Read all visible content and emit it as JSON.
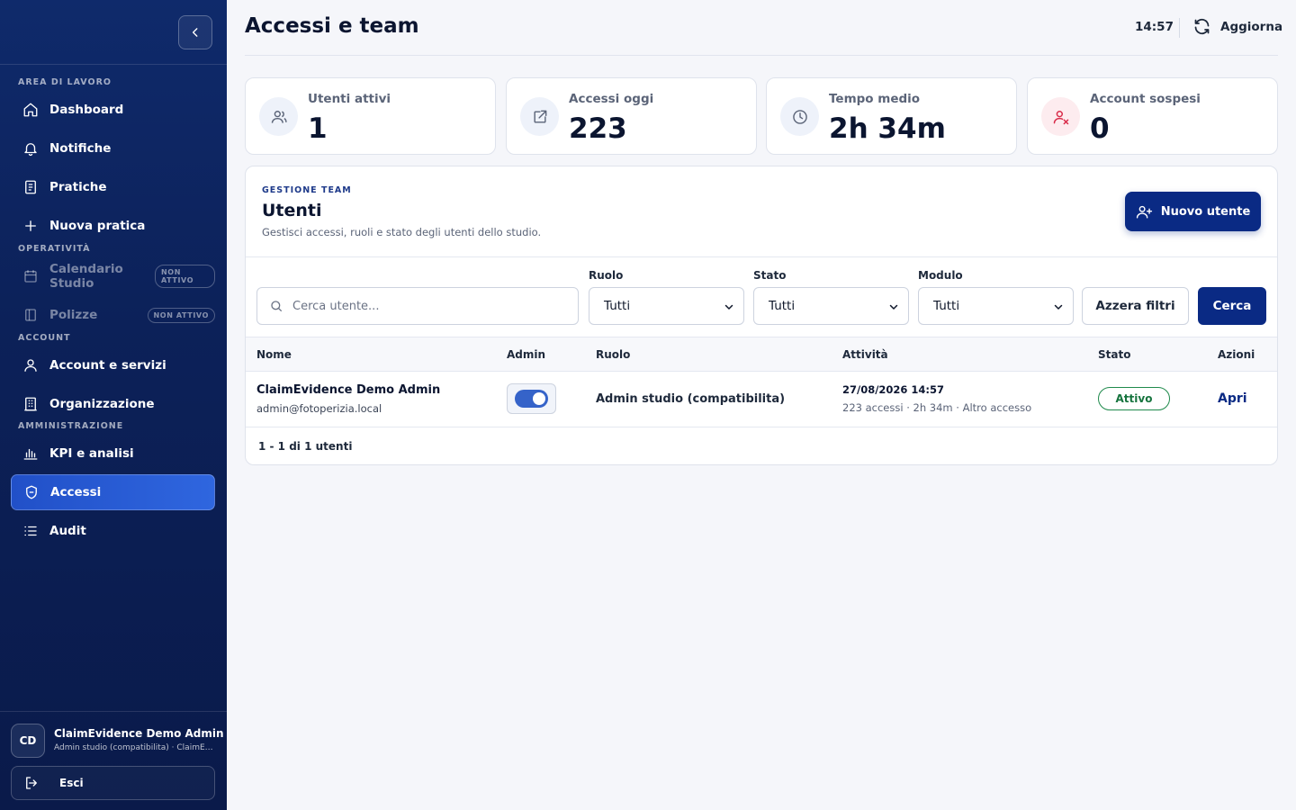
{
  "sidebar": {
    "sections": {
      "workspace": "AREA DI LAVORO",
      "operations": "OPERATIVITÀ",
      "account": "ACCOUNT",
      "admin": "AMMINISTRAZIONE"
    },
    "items": {
      "dashboard": "Dashboard",
      "notifications": "Notifiche",
      "practices": "Pratiche",
      "new_practice": "Nuova pratica",
      "calendar": "Calendario Studio",
      "policies": "Polizze",
      "account_services": "Account e servizi",
      "organization": "Organizzazione",
      "kpi": "KPI e analisi",
      "access": "Accessi",
      "audit": "Audit"
    },
    "inactive_badge": "NON ATTIVO",
    "user": {
      "initials": "CD",
      "name": "ClaimEvidence Demo Admin",
      "role": "Admin studio (compatibilita) · ClaimEvidence"
    },
    "logout_label": "Esci"
  },
  "header": {
    "title": "Accessi e team",
    "clock": "14:57",
    "refresh_label": "Aggiorna"
  },
  "kpis": {
    "active_users": {
      "label": "Utenti attivi",
      "value": "1"
    },
    "access_today": {
      "label": "Accessi oggi",
      "value": "223"
    },
    "avg_time": {
      "label": "Tempo medio",
      "value": "2h 34m"
    },
    "suspended": {
      "label": "Account sospesi",
      "value": "0"
    }
  },
  "panel": {
    "eyebrow": "GESTIONE TEAM",
    "title": "Utenti",
    "subtitle": "Gestisci accessi, ruoli e stato degli utenti dello studio.",
    "new_user_label": "Nuovo utente"
  },
  "filters": {
    "search_placeholder": "Cerca utente...",
    "role_label": "Ruolo",
    "role_value": "Tutti",
    "state_label": "Stato",
    "state_value": "Tutti",
    "module_label": "Modulo",
    "module_value": "Tutti",
    "reset_label": "Azzera filtri",
    "search_label": "Cerca"
  },
  "table": {
    "columns": {
      "name": "Nome",
      "admin": "Admin",
      "role": "Ruolo",
      "activity": "Attività",
      "state": "Stato",
      "actions": "Azioni"
    },
    "rows": [
      {
        "name": "ClaimEvidence Demo Admin",
        "email": "admin@fotoperizia.local",
        "admin": true,
        "role": "Admin studio (compatibilita)",
        "activity_date": "27/08/2026 14:57",
        "activity_detail": "223 accessi · 2h 34m · Altro accesso",
        "state": "Attivo",
        "action": "Apri"
      }
    ],
    "pager": "1 - 1 di 1 utenti"
  },
  "colors": {
    "primary": "#0a2a84",
    "sidebar": "#0c2159",
    "active_nav": "#2f66df",
    "status_ok": "#1f8a4c",
    "alert": "#d92d4b"
  }
}
